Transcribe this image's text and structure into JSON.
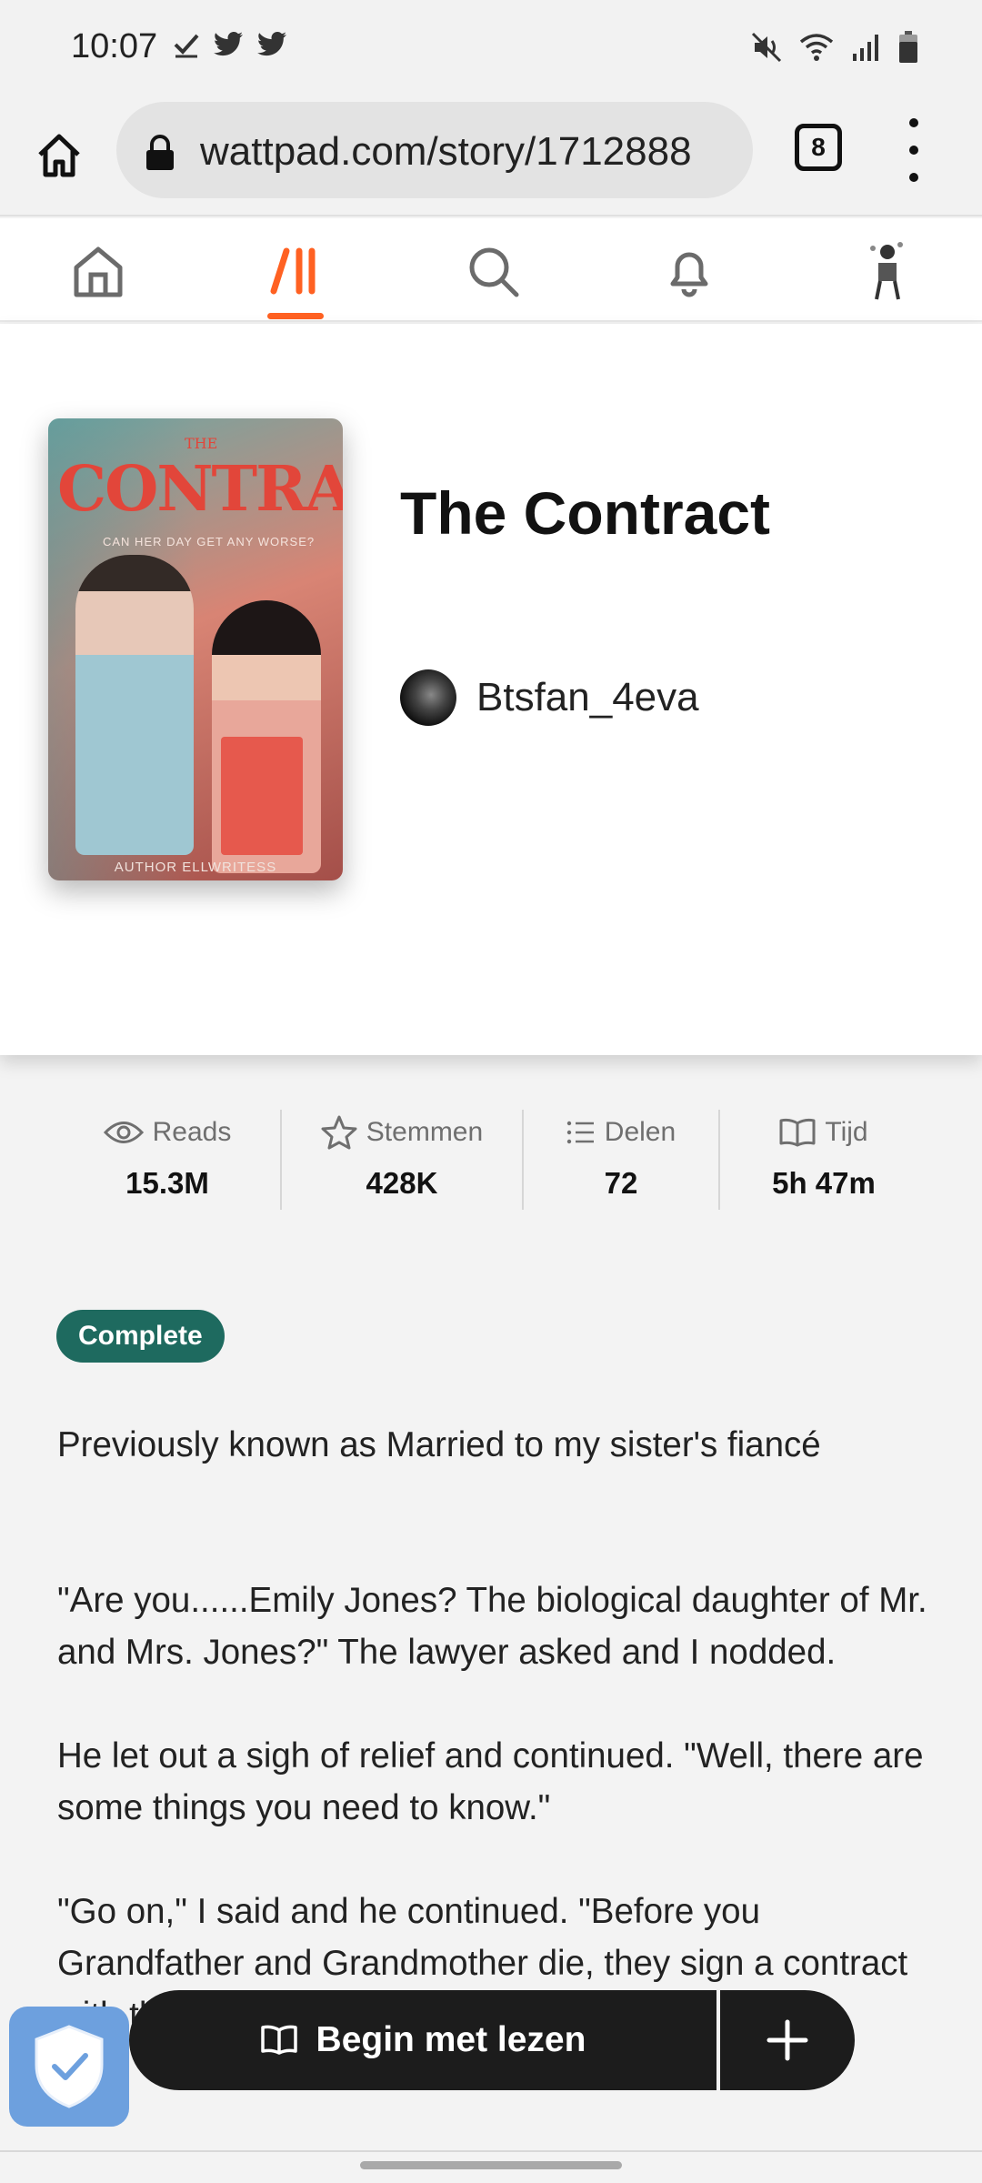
{
  "status_bar": {
    "time": "10:07"
  },
  "browser": {
    "url": "wattpad.com/story/1712888",
    "tab_count": "8"
  },
  "story": {
    "title": "The Contract",
    "author": "Btsfan_4eva",
    "cover": {
      "title": "CONTRACT",
      "small_title": "THE",
      "tagline": "CAN HER DAY GET ANY WORSE?",
      "author_line": "AUTHOR ELLWRITESS"
    },
    "stats": [
      {
        "label": "Reads",
        "value": "15.3M",
        "icon": "eye-icon"
      },
      {
        "label": "Stemmen",
        "value": "428K",
        "icon": "star-icon"
      },
      {
        "label": "Delen",
        "value": "72",
        "icon": "list-icon"
      },
      {
        "label": "Tijd",
        "value": "5h 47m",
        "icon": "book-icon"
      }
    ],
    "status_badge": "Complete",
    "description": [
      "Previously known as Married to my sister's fiancé",
      "\"Are you......Emily Jones? The biological daughter of Mr. and Mrs. Jones?\" The lawyer asked and I nodded.",
      "He let out a sigh of relief and continued. \"Well, there are some things you need to know.\"",
      "\"Go on,\" I said and he continued. \"Before you Grandfather and Grandmother die, they sign a contract with the family of the Stephano family as a wife\""
    ]
  },
  "actions": {
    "begin_reading": "Begin met lezen"
  },
  "colors": {
    "accent": "#ff6122",
    "badge": "#1e6a5f",
    "button": "#1c1c1c",
    "shield": "#6da0de"
  }
}
